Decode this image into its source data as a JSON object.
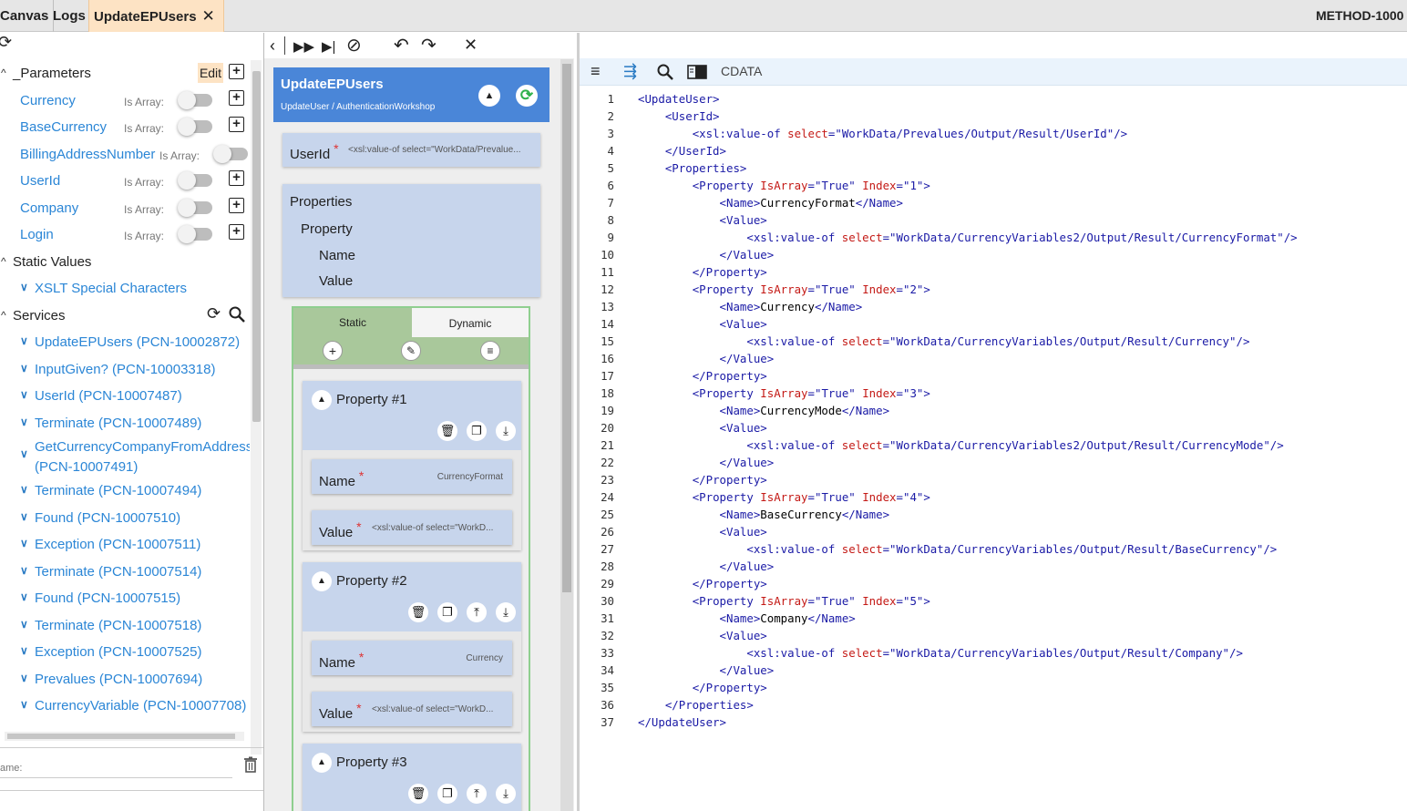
{
  "tabs": [
    {
      "label": "Canvas"
    },
    {
      "label": "Logs"
    },
    {
      "label": "UpdateEPUsers",
      "active": true
    }
  ],
  "tab_close": "✕",
  "method_id": "METHOD-1000",
  "left": {
    "parameters_title": "_Parameters",
    "edit_label": "Edit",
    "params": [
      {
        "name": "Currency",
        "is_array_label": "Is Array:"
      },
      {
        "name": "BaseCurrency",
        "is_array_label": "Is Array:"
      },
      {
        "name": "BillingAddressNumber",
        "is_array_label": "Is Array:"
      },
      {
        "name": "UserId",
        "is_array_label": "Is Array:"
      },
      {
        "name": "Company",
        "is_array_label": "Is Array:"
      },
      {
        "name": "Login",
        "is_array_label": "Is Array:"
      }
    ],
    "static_values_title": "Static Values",
    "xslt_special": "XSLT Special Characters",
    "services_title": "Services",
    "services": [
      "UpdateEPUsers (PCN-10002872)",
      "InputGiven? (PCN-10003318)",
      "UserId (PCN-10007487)",
      "Terminate (PCN-10007489)",
      "GetCurrencyCompanyFromAddress",
      "(PCN-10007491)",
      "Terminate (PCN-10007494)",
      "Found (PCN-10007510)",
      "Exception (PCN-10007511)",
      "Terminate (PCN-10007514)",
      "Found (PCN-10007515)",
      "Terminate (PCN-10007518)",
      "Exception (PCN-10007525)",
      "Prevalues (PCN-10007694)",
      "CurrencyVariable (PCN-10007708)"
    ],
    "name_placeholder": "ame:"
  },
  "middle": {
    "service_title": "UpdateEPUsers",
    "service_subtitle": "UpdateUser / AuthenticationWorkshop",
    "userid_label": "UserId",
    "userid_value": "<xsl:value-of select=\"WorkData/Prevalue...",
    "properties_label": "Properties",
    "property_label": "Property",
    "name_label": "Name",
    "value_label": "Value",
    "static_tab": "Static",
    "dynamic_tab": "Dynamic",
    "property_items": [
      {
        "title": "Property #1",
        "name_value": "CurrencyFormat",
        "value_value": "<xsl:value-of select=\"WorkD..."
      },
      {
        "title": "Property #2",
        "name_value": "Currency",
        "value_value": "<xsl:value-of select=\"WorkD..."
      },
      {
        "title": "Property #3"
      }
    ],
    "field_name_label": "Name",
    "field_value_label": "Value"
  },
  "code_toolbar": {
    "cdata_label": "CDATA"
  },
  "code_lines": [
    [
      [
        "tg",
        "<UpdateUser>"
      ]
    ],
    [
      [
        "p",
        "    "
      ],
      [
        "tg",
        "<UserId>"
      ]
    ],
    [
      [
        "p",
        "        "
      ],
      [
        "tg",
        "<xsl:value-of "
      ],
      [
        "an",
        "select"
      ],
      [
        "tg",
        "="
      ],
      [
        "av",
        "\"WorkData/Prevalues/Output/Result/UserId\""
      ],
      [
        "tg",
        "/>"
      ]
    ],
    [
      [
        "p",
        "    "
      ],
      [
        "tg",
        "</UserId>"
      ]
    ],
    [
      [
        "p",
        "    "
      ],
      [
        "tg",
        "<Properties>"
      ]
    ],
    [
      [
        "p",
        "        "
      ],
      [
        "tg",
        "<Property "
      ],
      [
        "an",
        "IsArray"
      ],
      [
        "tg",
        "="
      ],
      [
        "av",
        "\"True\" "
      ],
      [
        "an",
        "Index"
      ],
      [
        "tg",
        "="
      ],
      [
        "av",
        "\"1\""
      ],
      [
        "tg",
        ">"
      ]
    ],
    [
      [
        "p",
        "            "
      ],
      [
        "tg",
        "<Name>"
      ],
      [
        "p",
        "CurrencyFormat"
      ],
      [
        "tg",
        "</Name>"
      ]
    ],
    [
      [
        "p",
        "            "
      ],
      [
        "tg",
        "<Value>"
      ]
    ],
    [
      [
        "p",
        "                "
      ],
      [
        "tg",
        "<xsl:value-of "
      ],
      [
        "an",
        "select"
      ],
      [
        "tg",
        "="
      ],
      [
        "av",
        "\"WorkData/CurrencyVariables2/Output/Result/CurrencyFormat\""
      ],
      [
        "tg",
        "/>"
      ]
    ],
    [
      [
        "p",
        "            "
      ],
      [
        "tg",
        "</Value>"
      ]
    ],
    [
      [
        "p",
        "        "
      ],
      [
        "tg",
        "</Property>"
      ]
    ],
    [
      [
        "p",
        "        "
      ],
      [
        "tg",
        "<Property "
      ],
      [
        "an",
        "IsArray"
      ],
      [
        "tg",
        "="
      ],
      [
        "av",
        "\"True\" "
      ],
      [
        "an",
        "Index"
      ],
      [
        "tg",
        "="
      ],
      [
        "av",
        "\"2\""
      ],
      [
        "tg",
        ">"
      ]
    ],
    [
      [
        "p",
        "            "
      ],
      [
        "tg",
        "<Name>"
      ],
      [
        "p",
        "Currency"
      ],
      [
        "tg",
        "</Name>"
      ]
    ],
    [
      [
        "p",
        "            "
      ],
      [
        "tg",
        "<Value>"
      ]
    ],
    [
      [
        "p",
        "                "
      ],
      [
        "tg",
        "<xsl:value-of "
      ],
      [
        "an",
        "select"
      ],
      [
        "tg",
        "="
      ],
      [
        "av",
        "\"WorkData/CurrencyVariables/Output/Result/Currency\""
      ],
      [
        "tg",
        "/>"
      ]
    ],
    [
      [
        "p",
        "            "
      ],
      [
        "tg",
        "</Value>"
      ]
    ],
    [
      [
        "p",
        "        "
      ],
      [
        "tg",
        "</Property>"
      ]
    ],
    [
      [
        "p",
        "        "
      ],
      [
        "tg",
        "<Property "
      ],
      [
        "an",
        "IsArray"
      ],
      [
        "tg",
        "="
      ],
      [
        "av",
        "\"True\" "
      ],
      [
        "an",
        "Index"
      ],
      [
        "tg",
        "="
      ],
      [
        "av",
        "\"3\""
      ],
      [
        "tg",
        ">"
      ]
    ],
    [
      [
        "p",
        "            "
      ],
      [
        "tg",
        "<Name>"
      ],
      [
        "p",
        "CurrencyMode"
      ],
      [
        "tg",
        "</Name>"
      ]
    ],
    [
      [
        "p",
        "            "
      ],
      [
        "tg",
        "<Value>"
      ]
    ],
    [
      [
        "p",
        "                "
      ],
      [
        "tg",
        "<xsl:value-of "
      ],
      [
        "an",
        "select"
      ],
      [
        "tg",
        "="
      ],
      [
        "av",
        "\"WorkData/CurrencyVariables2/Output/Result/CurrencyMode\""
      ],
      [
        "tg",
        "/>"
      ]
    ],
    [
      [
        "p",
        "            "
      ],
      [
        "tg",
        "</Value>"
      ]
    ],
    [
      [
        "p",
        "        "
      ],
      [
        "tg",
        "</Property>"
      ]
    ],
    [
      [
        "p",
        "        "
      ],
      [
        "tg",
        "<Property "
      ],
      [
        "an",
        "IsArray"
      ],
      [
        "tg",
        "="
      ],
      [
        "av",
        "\"True\" "
      ],
      [
        "an",
        "Index"
      ],
      [
        "tg",
        "="
      ],
      [
        "av",
        "\"4\""
      ],
      [
        "tg",
        ">"
      ]
    ],
    [
      [
        "p",
        "            "
      ],
      [
        "tg",
        "<Name>"
      ],
      [
        "p",
        "BaseCurrency"
      ],
      [
        "tg",
        "</Name>"
      ]
    ],
    [
      [
        "p",
        "            "
      ],
      [
        "tg",
        "<Value>"
      ]
    ],
    [
      [
        "p",
        "                "
      ],
      [
        "tg",
        "<xsl:value-of "
      ],
      [
        "an",
        "select"
      ],
      [
        "tg",
        "="
      ],
      [
        "av",
        "\"WorkData/CurrencyVariables/Output/Result/BaseCurrency\""
      ],
      [
        "tg",
        "/>"
      ]
    ],
    [
      [
        "p",
        "            "
      ],
      [
        "tg",
        "</Value>"
      ]
    ],
    [
      [
        "p",
        "        "
      ],
      [
        "tg",
        "</Property>"
      ]
    ],
    [
      [
        "p",
        "        "
      ],
      [
        "tg",
        "<Property "
      ],
      [
        "an",
        "IsArray"
      ],
      [
        "tg",
        "="
      ],
      [
        "av",
        "\"True\" "
      ],
      [
        "an",
        "Index"
      ],
      [
        "tg",
        "="
      ],
      [
        "av",
        "\"5\""
      ],
      [
        "tg",
        ">"
      ]
    ],
    [
      [
        "p",
        "            "
      ],
      [
        "tg",
        "<Name>"
      ],
      [
        "p",
        "Company"
      ],
      [
        "tg",
        "</Name>"
      ]
    ],
    [
      [
        "p",
        "            "
      ],
      [
        "tg",
        "<Value>"
      ]
    ],
    [
      [
        "p",
        "                "
      ],
      [
        "tg",
        "<xsl:value-of "
      ],
      [
        "an",
        "select"
      ],
      [
        "tg",
        "="
      ],
      [
        "av",
        "\"WorkData/CurrencyVariables/Output/Result/Company\""
      ],
      [
        "tg",
        "/>"
      ]
    ],
    [
      [
        "p",
        "            "
      ],
      [
        "tg",
        "</Value>"
      ]
    ],
    [
      [
        "p",
        "        "
      ],
      [
        "tg",
        "</Property>"
      ]
    ],
    [
      [
        "p",
        "    "
      ],
      [
        "tg",
        "</Properties>"
      ]
    ],
    [
      [
        "tg",
        "</UpdateUser>"
      ]
    ]
  ],
  "colors": {
    "accent_blue": "#4a86d8",
    "tab_active": "#fde3c4",
    "link": "#2b86d6",
    "green_border": "#8fcf8f"
  }
}
